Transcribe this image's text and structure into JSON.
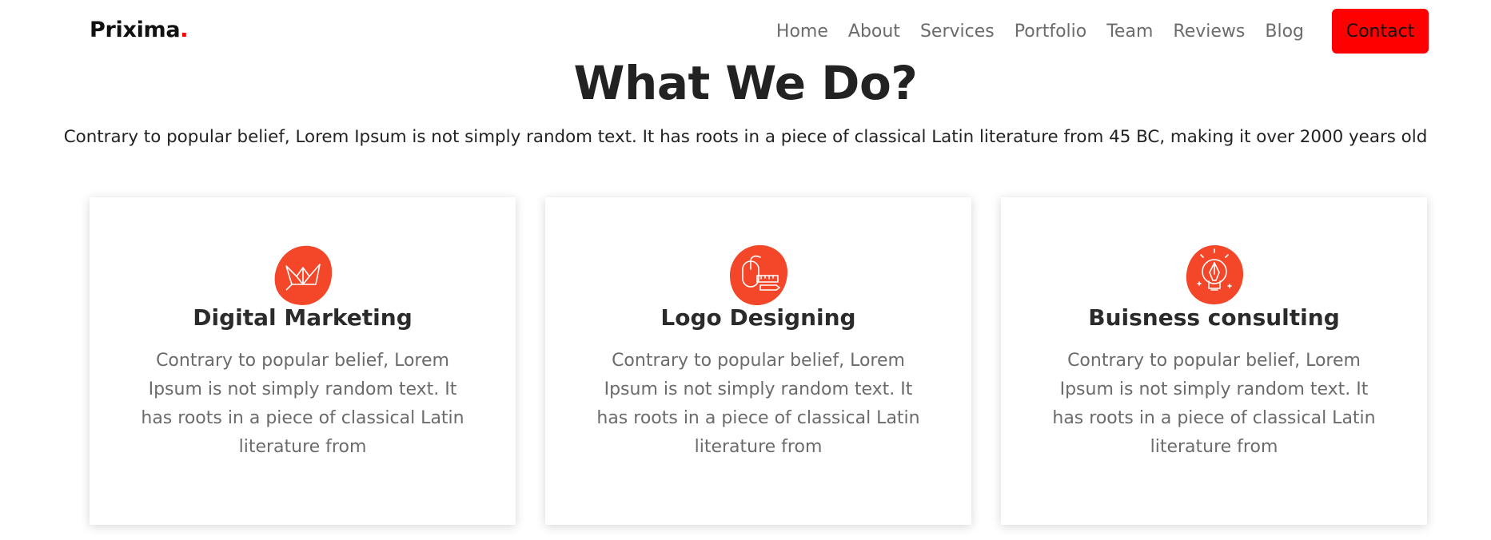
{
  "navbar": {
    "brand": "Prixima",
    "brand_dot": ".",
    "links": [
      "Home",
      "About",
      "Services",
      "Portfolio",
      "Team",
      "Reviews",
      "Blog"
    ],
    "contact_label": "Contact"
  },
  "section": {
    "title": "What We Do?",
    "subtitle": "Contrary to popular belief, Lorem Ipsum is not simply random text. It has roots in a piece of classical Latin literature from 45 BC, making it over 2000 years old"
  },
  "cards": [
    {
      "icon": "paper-crane-icon",
      "title": "Digital Marketing",
      "text": "Contrary to popular belief, Lorem Ipsum is not simply random text. It has roots in a piece of classical Latin literature from"
    },
    {
      "icon": "mouse-pen-ruler-icon",
      "title": "Logo Designing",
      "text": "Contrary to popular belief, Lorem Ipsum is not simply random text. It has roots in a piece of classical Latin literature from"
    },
    {
      "icon": "lightbulb-pen-icon",
      "title": "Buisness consulting",
      "text": "Contrary to popular belief, Lorem Ipsum is not simply random text. It has roots in a piece of classical Latin literature from"
    }
  ],
  "colors": {
    "accent": "#ff0000",
    "icon_blob": "#f4472a"
  }
}
